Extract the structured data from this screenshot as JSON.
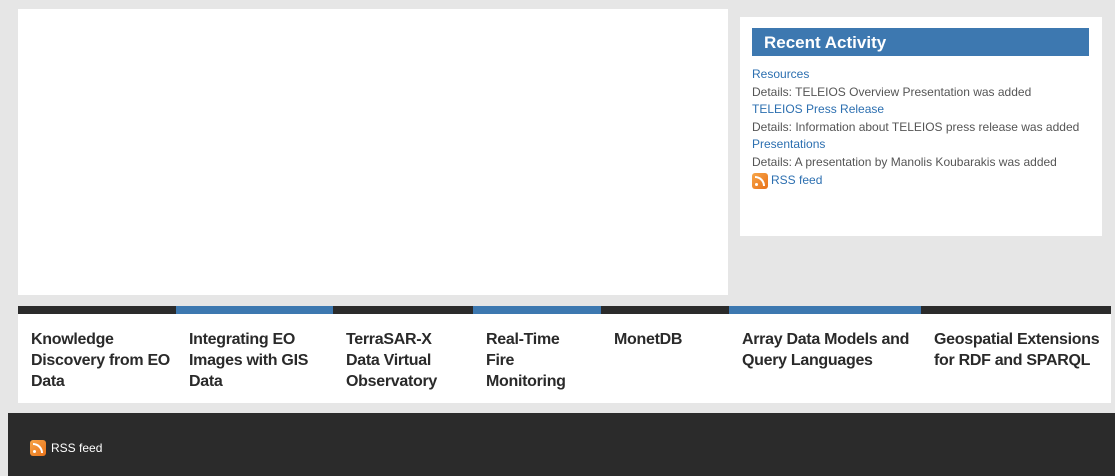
{
  "recent_activity": {
    "title": "Recent Activity",
    "items": [
      {
        "link": "Resources",
        "details": "Details: TELEIOS Overview Presentation was added"
      },
      {
        "link": "TELEIOS Press Release",
        "details": "Details: Information about TELEIOS press release was added"
      },
      {
        "link": "Presentations",
        "details": "Details: A presentation by Manolis Koubarakis was added"
      }
    ],
    "rss_label": "RSS feed",
    "rss_icon": "rss-icon"
  },
  "projects": [
    {
      "label": "Knowledge Discovery from EO Data",
      "accent": "#2b2b2b"
    },
    {
      "label": "Integrating EO Images with GIS Data",
      "accent": "#3d78b0"
    },
    {
      "label": "TerraSAR-X Data Virtual Observatory",
      "accent": "#2b2b2b"
    },
    {
      "label": "Real-Time Fire Monitoring",
      "accent": "#3d78b0"
    },
    {
      "label": "MonetDB",
      "accent": "#2b2b2b"
    },
    {
      "label": "Array Data Models and Query Languages",
      "accent": "#3d78b0"
    },
    {
      "label": "Geospatial Extensions for RDF and SPARQL",
      "accent": "#2b2b2b"
    }
  ],
  "footer": {
    "rss_label": "RSS feed",
    "rss_icon": "rss-icon"
  },
  "colors": {
    "accent_blue": "#3d78b0",
    "dark": "#2b2b2b",
    "link": "#2c6fb0"
  }
}
